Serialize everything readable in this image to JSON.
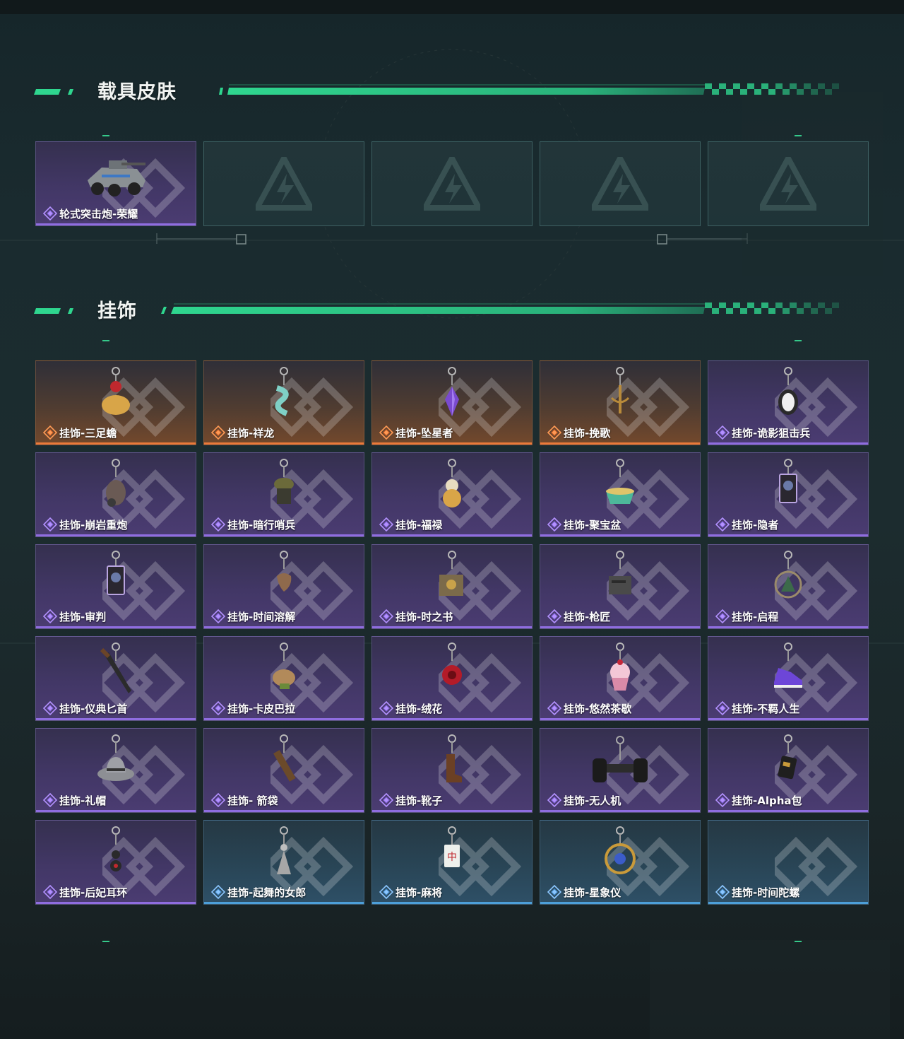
{
  "sections": {
    "vehicle": {
      "title": "载具皮肤",
      "items": [
        {
          "name": "轮式突击炮-荣耀",
          "rarity": "purple",
          "icon": "armored-car-icon"
        },
        {
          "name": "",
          "rarity": "empty"
        },
        {
          "name": "",
          "rarity": "empty"
        },
        {
          "name": "",
          "rarity": "empty"
        },
        {
          "name": "",
          "rarity": "empty"
        }
      ]
    },
    "charms": {
      "title": "挂饰",
      "items": [
        {
          "name": "挂饰-三足蟾",
          "rarity": "orange",
          "icon": "three-legged-toad-icon"
        },
        {
          "name": "挂饰-祥龙",
          "rarity": "orange",
          "icon": "dragon-icon"
        },
        {
          "name": "挂饰-坠星者",
          "rarity": "orange",
          "icon": "crystal-icon"
        },
        {
          "name": "挂饰-挽歌",
          "rarity": "orange",
          "icon": "sigil-icon"
        },
        {
          "name": "挂饰-诡影狙击兵",
          "rarity": "purple",
          "icon": "penguin-icon"
        },
        {
          "name": "挂饰-崩岩重炮",
          "rarity": "purple",
          "icon": "bomb-figure-icon"
        },
        {
          "name": "挂饰-暗行哨兵",
          "rarity": "purple",
          "icon": "soldier-figure-icon"
        },
        {
          "name": "挂饰-福禄",
          "rarity": "purple",
          "icon": "gourd-icon"
        },
        {
          "name": "挂饰-聚宝盆",
          "rarity": "purple",
          "icon": "treasure-bowl-icon"
        },
        {
          "name": "挂饰-隐者",
          "rarity": "purple",
          "icon": "tarot-card-icon"
        },
        {
          "name": "挂饰-审判",
          "rarity": "purple",
          "icon": "tarot-card-icon"
        },
        {
          "name": "挂饰-时间溶解",
          "rarity": "purple",
          "icon": "melting-clock-icon"
        },
        {
          "name": "挂饰-时之书",
          "rarity": "purple",
          "icon": "book-icon"
        },
        {
          "name": "挂饰-枪匠",
          "rarity": "purple",
          "icon": "gun-part-icon"
        },
        {
          "name": "挂饰-启程",
          "rarity": "purple",
          "icon": "emblem-icon"
        },
        {
          "name": "挂饰-仪典匕首",
          "rarity": "purple",
          "icon": "dagger-icon"
        },
        {
          "name": "挂饰-卡皮巴拉",
          "rarity": "purple",
          "icon": "capybara-icon"
        },
        {
          "name": "挂饰-绒花",
          "rarity": "purple",
          "icon": "red-flower-icon"
        },
        {
          "name": "挂饰-悠然茶歇",
          "rarity": "purple",
          "icon": "cupcake-icon"
        },
        {
          "name": "挂饰-不羁人生",
          "rarity": "purple",
          "icon": "sneaker-icon"
        },
        {
          "name": "挂饰-礼帽",
          "rarity": "purple",
          "icon": "hat-icon"
        },
        {
          "name": "挂饰- 箭袋",
          "rarity": "purple",
          "icon": "quiver-icon"
        },
        {
          "name": "挂饰-靴子",
          "rarity": "purple",
          "icon": "boot-icon"
        },
        {
          "name": "挂饰-无人机",
          "rarity": "purple",
          "icon": "drone-icon"
        },
        {
          "name": "挂饰-Alpha包",
          "rarity": "purple",
          "icon": "pouch-icon"
        },
        {
          "name": "挂饰-后妃耳环",
          "rarity": "purple",
          "icon": "earring-icon"
        },
        {
          "name": "挂饰-起舞的女郎",
          "rarity": "blue",
          "icon": "dancer-icon"
        },
        {
          "name": "挂饰-麻将",
          "rarity": "blue",
          "icon": "mahjong-tile-icon"
        },
        {
          "name": "挂饰-星象仪",
          "rarity": "blue",
          "icon": "astrolabe-icon"
        },
        {
          "name": "挂饰-时间陀螺",
          "rarity": "blue",
          "icon": ""
        }
      ]
    }
  },
  "colors": {
    "accent_green": "#2fd68f",
    "purple": "#8f6de0",
    "orange": "#ec7a3a",
    "blue": "#4d9fd9"
  }
}
